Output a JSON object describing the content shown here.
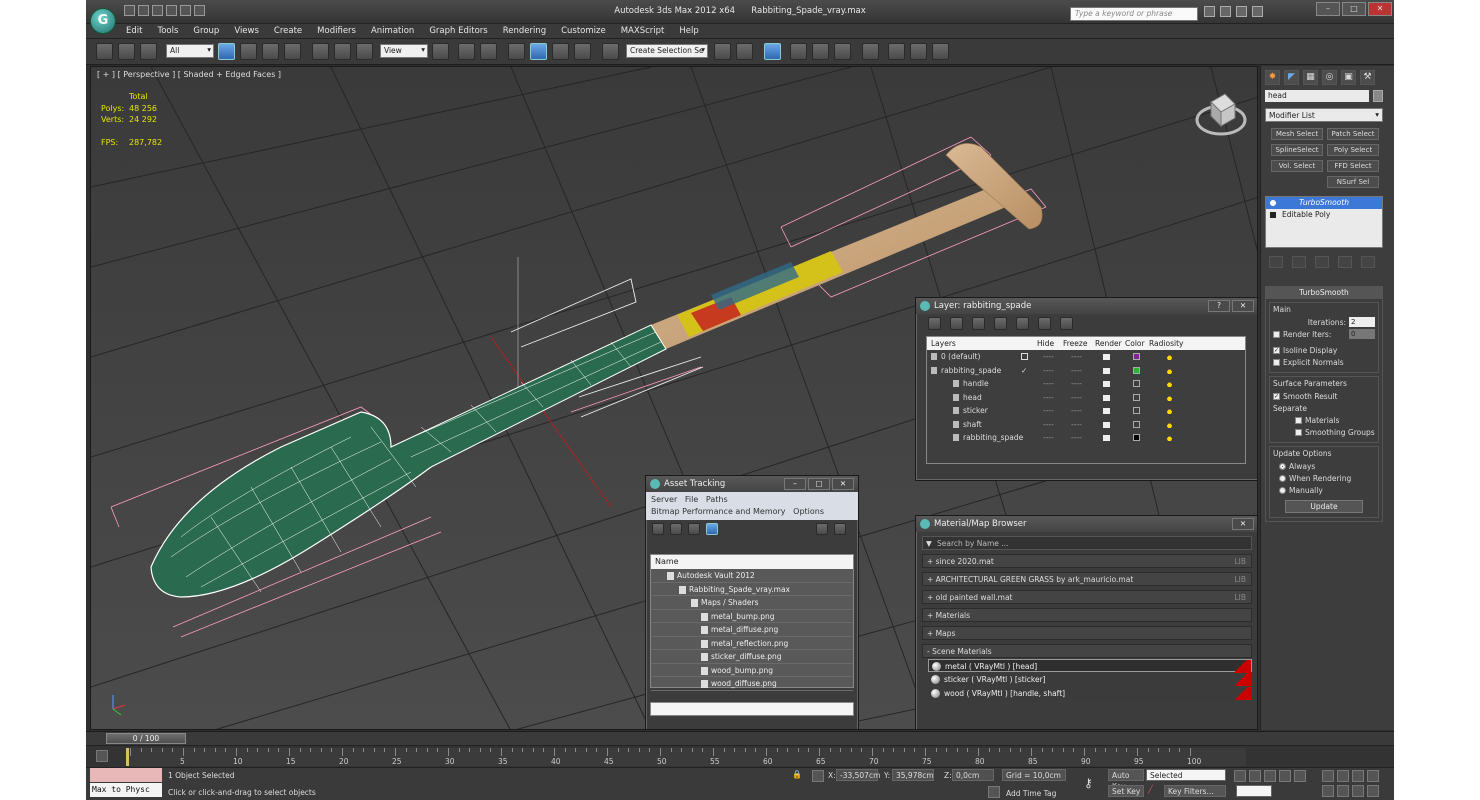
{
  "window": {
    "app_title": "Autodesk 3ds Max  2012 x64",
    "file_title": "Rabbiting_Spade_vray.max",
    "search_placeholder": "Type a keyword or phrase"
  },
  "menu": [
    "Edit",
    "Tools",
    "Group",
    "Views",
    "Create",
    "Modifiers",
    "Animation",
    "Graph Editors",
    "Rendering",
    "Customize",
    "MAXScript",
    "Help"
  ],
  "toolbar": {
    "selection_filter": "All",
    "ref_coord": "View",
    "named_selection": "Create Selection Se"
  },
  "viewport": {
    "label": "[ + ] [ Perspective ] [ Shaded + Edged Faces ]",
    "stats": {
      "total_label": "Total",
      "polys_label": "Polys:",
      "polys": "48 256",
      "verts_label": "Verts:",
      "verts": "24 292",
      "fps_label": "FPS:",
      "fps": "287,782"
    },
    "colors": {
      "wire": "#ffffff",
      "wire_green": "#2a6b4f",
      "bbox": "#ff9cc4",
      "wood": "#caa37a",
      "sticker": "#d4c21a"
    }
  },
  "command_panel": {
    "object_name": "head",
    "modifier_list": "Modifier List",
    "mod_buttons": [
      "Mesh Select",
      "Patch Select",
      "SplineSelect",
      "Poly Select",
      "Vol. Select",
      "FFD Select",
      "",
      "NSurf Sel"
    ],
    "stack": [
      "TurboSmooth",
      "Editable Poly"
    ],
    "turbosmooth": {
      "title": "TurboSmooth",
      "main": "Main",
      "iterations_label": "Iterations:",
      "iterations": "2",
      "render_iters_label": "Render Iters:",
      "render_iters": "0",
      "isoline": "Isoline Display",
      "explicit": "Explicit Normals",
      "surface_params": "Surface Parameters",
      "smooth_result": "Smooth Result",
      "separate": "Separate",
      "materials": "Materials",
      "smoothing_groups": "Smoothing Groups",
      "update_options": "Update Options",
      "always": "Always",
      "when_rendering": "When Rendering",
      "manually": "Manually",
      "update": "Update"
    }
  },
  "layer_dialog": {
    "title": "Layer: rabbiting_spade",
    "columns": [
      "Layers",
      "Hide",
      "Freeze",
      "Render",
      "Color",
      "Radiosity"
    ],
    "rows": [
      {
        "name": "0 (default)",
        "dash1": "----",
        "dash2": "----",
        "color": "#8a1ea0",
        "indent": 14
      },
      {
        "name": "rabbiting_spade",
        "dash1": "----",
        "dash2": "----",
        "color": "#28b828",
        "indent": 14
      },
      {
        "name": "handle",
        "dash1": "----",
        "dash2": "----",
        "color": "#3e3e3e",
        "indent": 36
      },
      {
        "name": "head",
        "dash1": "----",
        "dash2": "----",
        "color": "#3e3e3e",
        "indent": 36
      },
      {
        "name": "sticker",
        "dash1": "----",
        "dash2": "----",
        "color": "#3e3e3e",
        "indent": 36
      },
      {
        "name": "shaft",
        "dash1": "----",
        "dash2": "----",
        "color": "#3e3e3e",
        "indent": 36
      },
      {
        "name": "rabbiting_spade",
        "dash1": "----",
        "dash2": "----",
        "color": "#000000",
        "indent": 36
      }
    ]
  },
  "asset_tracking": {
    "title": "Asset Tracking",
    "menu1": [
      "Server",
      "File",
      "Paths"
    ],
    "menu2": [
      "Bitmap Performance and Memory",
      "Options"
    ],
    "col_name": "Name",
    "rows": [
      {
        "name": "Autodesk Vault 2012",
        "indent": 26
      },
      {
        "name": "Rabbiting_Spade_vray.max",
        "indent": 38
      },
      {
        "name": "Maps / Shaders",
        "indent": 50
      },
      {
        "name": "metal_bump.png",
        "indent": 60
      },
      {
        "name": "metal_diffuse.png",
        "indent": 60
      },
      {
        "name": "metal_reflection.png",
        "indent": 60
      },
      {
        "name": "sticker_diffuse.png",
        "indent": 60
      },
      {
        "name": "wood_bump.png",
        "indent": 60
      },
      {
        "name": "wood_diffuse.png",
        "indent": 60
      }
    ]
  },
  "material_browser": {
    "title": "Material/Map Browser",
    "search_placeholder": "Search by Name ...",
    "libraries": [
      {
        "label": "+ since 2020.mat",
        "lib": "LIB"
      },
      {
        "label": "+ ARCHITECTURAL GREEN GRASS by ark_mauricio.mat",
        "lib": "LIB"
      },
      {
        "label": "+ old painted wall.mat",
        "lib": "LIB"
      },
      {
        "label": "+ Materials",
        "lib": ""
      },
      {
        "label": "+ Maps",
        "lib": ""
      },
      {
        "label": "- Scene Materials",
        "lib": ""
      }
    ],
    "scene_materials": [
      "metal  ( VRayMtl )  [head]",
      "sticker  ( VRayMtl )  [sticker]",
      "wood  ( VRayMtl )  [handle, shaft]"
    ]
  },
  "timeline": {
    "slider": "0 / 100",
    "ticks": [
      "5",
      "10",
      "15",
      "20",
      "25",
      "30",
      "35",
      "40",
      "45",
      "50",
      "55",
      "60",
      "65",
      "70",
      "75",
      "80",
      "85",
      "90",
      "95",
      "100"
    ]
  },
  "status": {
    "maxscript": "Max to Physc",
    "selected": "1 Object Selected",
    "prompt": "Click or click-and-drag to select objects",
    "x_label": "X:",
    "x": "-33,507cm",
    "y_label": "Y:",
    "y": "35,978cm",
    "z_label": "Z:",
    "z": "0,0cm",
    "grid": "Grid = 10,0cm",
    "add_time_tag": "Add Time Tag",
    "auto_key": "Auto Key",
    "set_key": "Set Key",
    "key_mode": "Selected",
    "key_filters": "Key Filters..."
  }
}
